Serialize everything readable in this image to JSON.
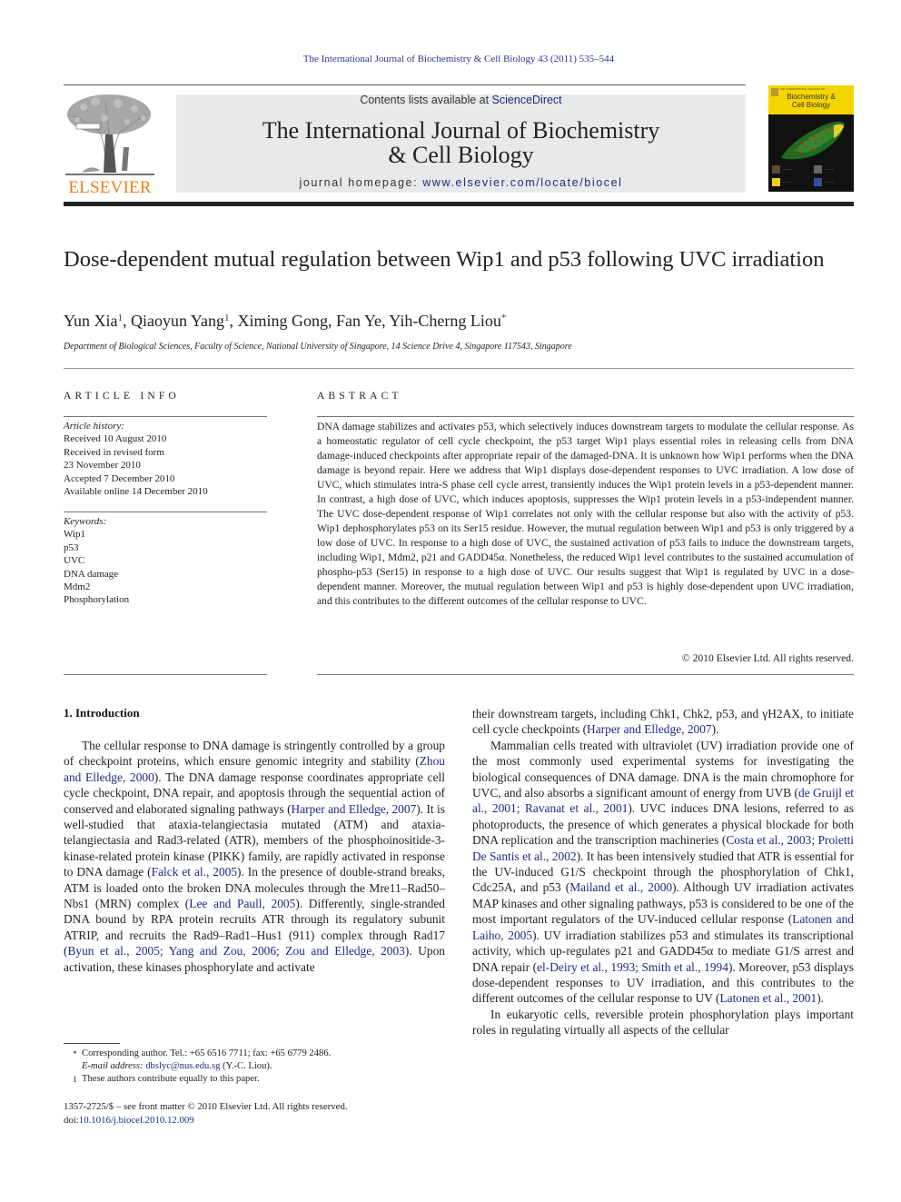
{
  "journal_citation": "The International Journal of Biochemistry & Cell Biology 43 (2011) 535–544",
  "masthead": {
    "publisher": "ELSEVIER",
    "contents_prefix": "Contents lists available at ",
    "contents_link": "ScienceDirect",
    "journal_title_line1": "The International Journal of Biochemistry",
    "journal_title_line2": "& Cell Biology",
    "homepage_prefix": "journal homepage: ",
    "homepage_link": "www.elsevier.com/locate/biocel",
    "cover_title_line1": "Biochemistry &",
    "cover_title_line2": "Cell Biology",
    "brand_orange": "#f07d1a",
    "cover_yellow": "#f5d500",
    "link_color": "#1f2a80"
  },
  "article": {
    "title": "Dose-dependent mutual regulation between Wip1 and p53 following UVC irradiation",
    "authors": [
      {
        "name": "Yun Xia",
        "mark": "1"
      },
      {
        "name": "Qiaoyun Yang",
        "mark": "1"
      },
      {
        "name": "Ximing Gong",
        "mark": ""
      },
      {
        "name": "Fan Ye",
        "mark": ""
      },
      {
        "name": "Yih-Cherng Liou",
        "mark": "*"
      }
    ],
    "affiliation": "Department of Biological Sciences, Faculty of Science, National University of Singapore, 14 Science Drive 4, Singapore 117543, Singapore"
  },
  "article_info": {
    "heading": "ARTICLE INFO",
    "history_label": "Article history:",
    "history": [
      "Received 10 August 2010",
      "Received in revised form",
      "23 November 2010",
      "Accepted 7 December 2010",
      "Available online 14 December 2010"
    ],
    "keywords_label": "Keywords:",
    "keywords": [
      "Wip1",
      "p53",
      "UVC",
      "DNA damage",
      "Mdm2",
      "Phosphorylation"
    ]
  },
  "abstract": {
    "heading": "ABSTRACT",
    "text": "DNA damage stabilizes and activates p53, which selectively induces downstream targets to modulate the cellular response. As a homeostatic regulator of cell cycle checkpoint, the p53 target Wip1 plays essential roles in releasing cells from DNA damage-induced checkpoints after appropriate repair of the damaged-DNA. It is unknown how Wip1 performs when the DNA damage is beyond repair. Here we address that Wip1 displays dose-dependent responses to UVC irradiation. A low dose of UVC, which stimulates intra-S phase cell cycle arrest, transiently induces the Wip1 protein levels in a p53-dependent manner. In contrast, a high dose of UVC, which induces apoptosis, suppresses the Wip1 protein levels in a p53-independent manner. The UVC dose-dependent response of Wip1 correlates not only with the cellular response but also with the activity of p53. Wip1 dephosphorylates p53 on its Ser15 residue. However, the mutual regulation between Wip1 and p53 is only triggered by a low dose of UVC. In response to a high dose of UVC, the sustained activation of p53 fails to induce the downstream targets, including Wip1, Mdm2, p21 and GADD45α. Nonetheless, the reduced Wip1 level contributes to the sustained accumulation of phospho-p53 (Ser15) in response to a high dose of UVC. Our results suggest that Wip1 is regulated by UVC in a dose-dependent manner. Moreover, the mutual regulation between Wip1 and p53 is highly dose-dependent upon UVC irradiation, and this contributes to the different outcomes of the cellular response to UVC.",
    "copyright": "© 2010 Elsevier Ltd. All rights reserved."
  },
  "introduction": {
    "heading": "1.  Introduction",
    "left_col": [
      {
        "t": "The cellular response to DNA damage is stringently controlled by a group of checkpoint proteins, which ensure genomic integrity and stability ",
        "ref": "Zhou and Elledge, 2000",
        "t2": ". The DNA damage response coordinates appropriate cell cycle checkpoint, DNA repair, and apoptosis through the sequential action of conserved and elaborated signaling pathways ",
        "ref2": "Harper and Elledge, 2007",
        "t3": "). It is well-studied that ataxia-telangiectasia mutated (ATM) and ataxia-telangiectasia and Rad3-related (ATR), members of the phosphoinositide-3-kinase-related protein kinase (PIKK) family, are rapidly activated in response to DNA damage (",
        "ref3": "Falck et al., 2005",
        "t4": "). In the presence of double-strand breaks, ATM is loaded onto the broken DNA molecules through the Mre11–Rad50–Nbs1 (MRN) complex (",
        "ref4": "Lee and Paull, 2005",
        "t5": "). Differently, single-stranded DNA bound by RPA protein recruits ATR through its regulatory subunit ATRIP, and recruits the Rad9–Rad1–Hus1 (911) complex through Rad17 (",
        "ref5": "Byun et al., 2005; Yang and Zou, 2006; Zou and Elledge, 2003",
        "t6": "). Upon activation, these kinases phosphorylate and activate"
      }
    ],
    "right_col": {
      "p1_text": "their downstream targets, including Chk1, Chk2, p53, and γH2AX, to initiate cell cycle checkpoints (",
      "p1_ref": "Harper and Elledge, 2007",
      "p1_end": ").",
      "p2_a": "Mammalian cells treated with ultraviolet (UV) irradiation provide one of the most commonly used experimental systems for investigating the biological consequences of DNA damage. DNA is the main chromophore for UVC, and also absorbs a significant amount of energy from UVB (",
      "p2_ref1": "de Gruijl et al., 2001; Ravanat et al., 2001",
      "p2_b": "). UVC induces DNA lesions, referred to as photoproducts, the presence of which generates a physical blockade for both DNA replication and the transcription machineries (",
      "p2_ref2": "Costa et al., 2003; Proietti De Santis et al., 2002",
      "p2_c": "). It has been intensively studied that ATR is essential for the UV-induced G1/S checkpoint through the phosphorylation of Chk1, Cdc25A, and p53 (",
      "p2_ref3": "Mailand et al., 2000",
      "p2_d": "). Although UV irradiation activates MAP kinases and other signaling pathways, p53 is considered to be one of the most important regulators of the UV-induced cellular response (",
      "p2_ref4": "Latonen and Laiho, 2005",
      "p2_e": "). UV irradiation stabilizes p53 and stimulates its transcriptional activity, which up-regulates p21 and GADD45α to mediate G1/S arrest and DNA repair (",
      "p2_ref5": "el-Deiry et al., 1993; Smith et al., 1994",
      "p2_f": "). Moreover, p53 displays dose-dependent responses to UV irradiation, and this contributes to the different outcomes of the cellular response to UV (",
      "p2_ref6": "Latonen et al., 2001",
      "p2_g": ").",
      "p3": "In eukaryotic cells, reversible protein phosphorylation plays important roles in regulating virtually all aspects of the cellular"
    }
  },
  "footnotes": {
    "corresponding_mark": "*",
    "corresponding": "Corresponding author. Tel.: +65 6516 7711; fax: +65 6779 2486.",
    "email_label": "E-mail address: ",
    "email": "dbslyc@nus.edu.sg",
    "email_suffix": " (Y.-C. Liou).",
    "equal_mark": "1",
    "equal": "These authors contribute equally to this paper."
  },
  "bottom_meta": {
    "issn_line": "1357-2725/$ – see front matter © 2010 Elsevier Ltd. All rights reserved.",
    "doi_prefix": "doi:",
    "doi": "10.1016/j.biocel.2010.12.009"
  }
}
